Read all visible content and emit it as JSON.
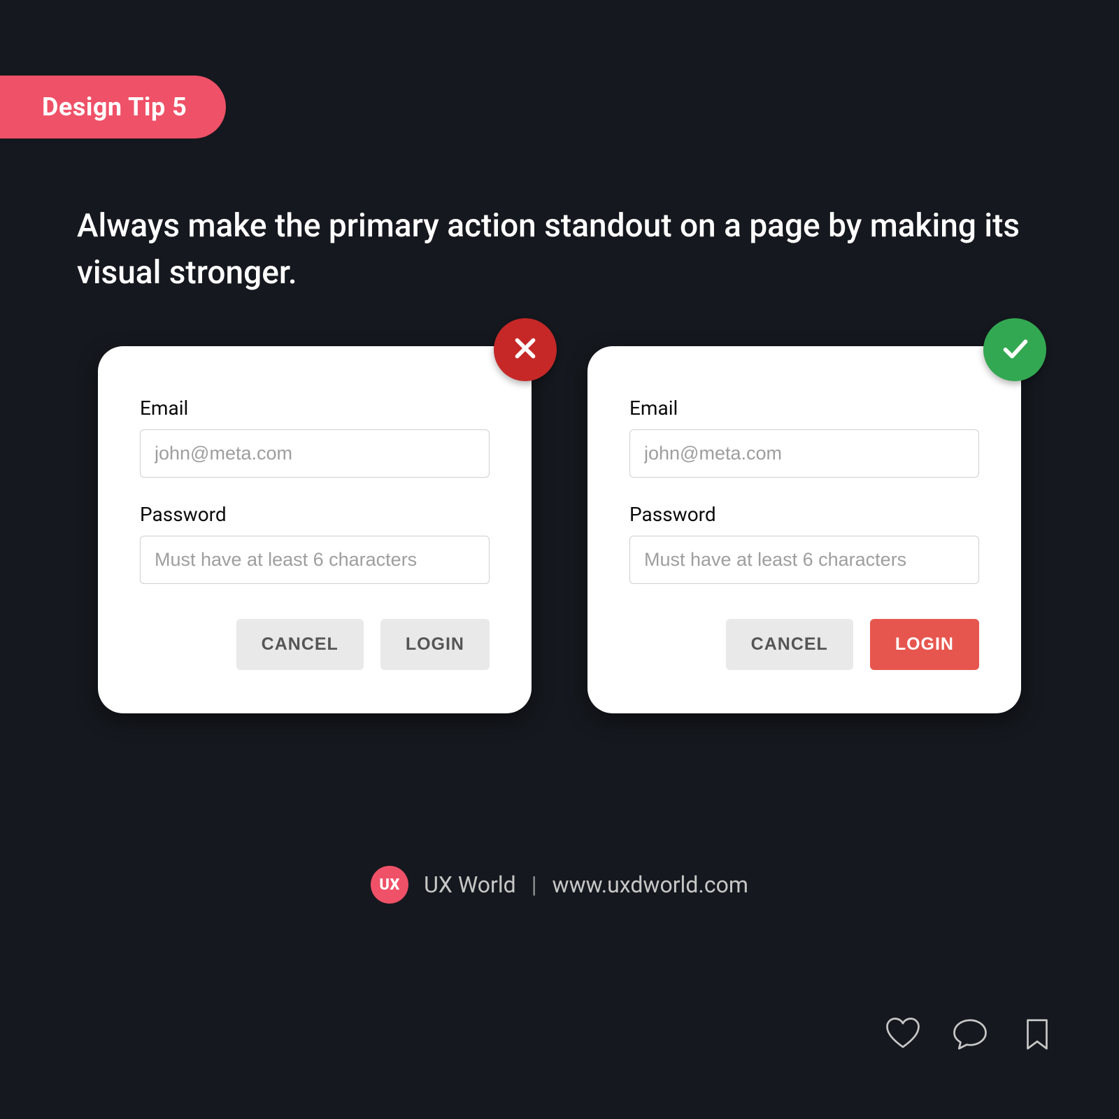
{
  "tag": {
    "label": "Design Tip 5"
  },
  "headline": "Always make the primary action standout on a page by making its visual stronger.",
  "card_bad": {
    "status": "bad",
    "email_label": "Email",
    "email_placeholder": "john@meta.com",
    "password_label": "Password",
    "password_placeholder": "Must have at least 6 characters",
    "cancel_label": "CANCEL",
    "login_label": "LOGIN"
  },
  "card_good": {
    "status": "good",
    "email_label": "Email",
    "email_placeholder": "john@meta.com",
    "password_label": "Password",
    "password_placeholder": "Must have at least 6 characters",
    "cancel_label": "CANCEL",
    "login_label": "LOGIN"
  },
  "credit": {
    "logo_text": "UX",
    "brand": "UX World",
    "separator": "|",
    "url": "www.uxdworld.com"
  },
  "colors": {
    "background": "#15181e",
    "accent_pink": "#ef5168",
    "badge_red": "#c62828",
    "badge_green": "#33a852",
    "button_accent": "#e7564e"
  }
}
